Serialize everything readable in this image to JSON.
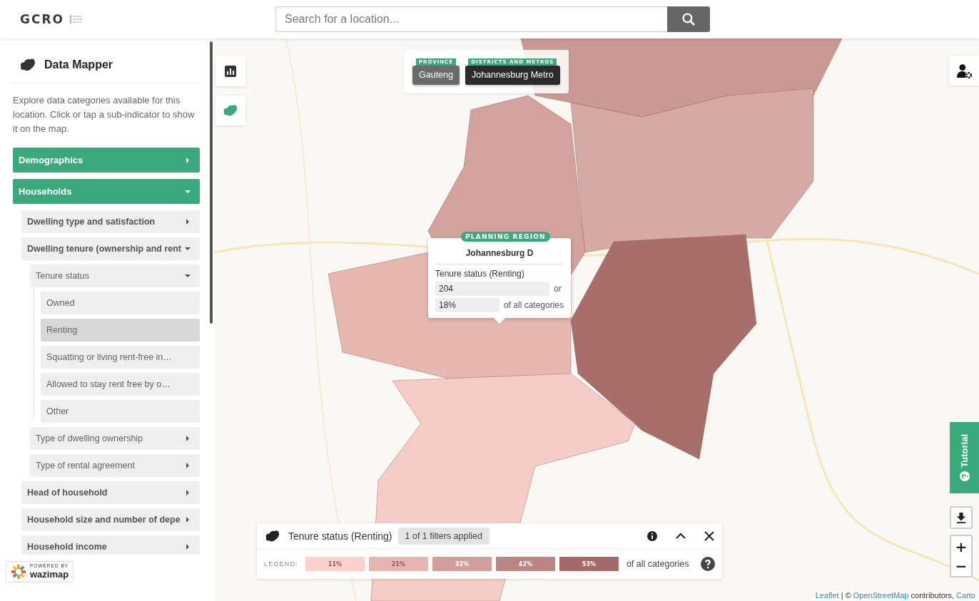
{
  "header": {
    "logo": "GCRO",
    "search": {
      "placeholder": "Search for a location..."
    }
  },
  "sidebar": {
    "title": "Data Mapper",
    "intro": "Explore data categories available for this location. Click or tap a sub-indicator to show it on the map.",
    "categories": [
      {
        "label": "Demographics",
        "expanded": false
      },
      {
        "label": "Households",
        "expanded": true,
        "children": [
          {
            "label": "Dwelling type and satisfaction",
            "expanded": false
          },
          {
            "label": "Dwelling tenure (ownership and rent",
            "expanded": true,
            "children": [
              {
                "label": "Tenure status",
                "expanded": true,
                "children": [
                  {
                    "label": "Owned",
                    "selected": false
                  },
                  {
                    "label": "Renting",
                    "selected": true
                  },
                  {
                    "label": "Squatting or living rent-free in…",
                    "selected": false
                  },
                  {
                    "label": "Allowed to stay rent free by o…",
                    "selected": false
                  },
                  {
                    "label": "Other",
                    "selected": false
                  }
                ]
              },
              {
                "label": "Type of dwelling ownership",
                "expanded": false
              },
              {
                "label": "Type of rental agreement",
                "expanded": false
              }
            ]
          },
          {
            "label": "Head of household",
            "expanded": false
          },
          {
            "label": "Household size and number of depe",
            "expanded": false
          },
          {
            "label": "Household income",
            "expanded": false
          }
        ]
      }
    ],
    "badge": {
      "top": "POWERED BY",
      "name": "wazimap"
    }
  },
  "location_chips": [
    {
      "tag": "PROVINCE",
      "name": "Gauteng",
      "selected": false
    },
    {
      "tag": "DISTRICTS AND METROS",
      "name": "Johannesburg Metro",
      "selected": true
    }
  ],
  "tooltip": {
    "tag": "PLANNING REGION",
    "name": "Johannesburg D",
    "indicator": "Tenure status (Renting)",
    "value": "204",
    "value_suffix": "or",
    "percent": "18%",
    "percent_suffix": "of all categories"
  },
  "legend_panel": {
    "title": "Tenure status (Renting)",
    "filters": "1 of 1 filters applied",
    "legend_label": "LEGEND:",
    "suffix": "of all categories",
    "entries": [
      {
        "label": "11%",
        "color": "#fdd0c9"
      },
      {
        "label": "21%",
        "color": "#e6b5b0"
      },
      {
        "label": "32%",
        "color": "#d09f9a"
      },
      {
        "label": "42%",
        "color": "#b98683"
      },
      {
        "label": "53%",
        "color": "#a26b69"
      }
    ]
  },
  "tutorial": {
    "label": "Tutorial"
  },
  "zoom": {
    "in": "+",
    "out": "−"
  },
  "attribution": {
    "link_1": "Leaflet",
    "separator": " | © ",
    "link_2": "OpenStreetMap",
    "middle": " contributors, ",
    "link_3": "Carto"
  }
}
